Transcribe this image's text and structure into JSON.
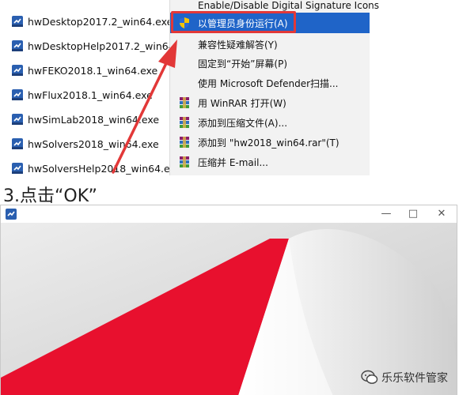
{
  "files": [
    {
      "name": "hwDesktop2017.2_win64.exe"
    },
    {
      "name": "hwDesktopHelp2017.2_win64.exe"
    },
    {
      "name": "hwFEKO2018.1_win64.exe"
    },
    {
      "name": "hwFlux2018.1_win64.exe"
    },
    {
      "name": "hwSimLab2018_win64.exe"
    },
    {
      "name": "hwSolvers2018_win64.exe"
    },
    {
      "name": "hwSolversHelp2018_win64.exe"
    }
  ],
  "context_menu": {
    "items": [
      {
        "label": "Enable/Disable Digital Signature Icons",
        "icon": "none"
      },
      {
        "label": "以管理员身份运行(A)",
        "icon": "shield-icon",
        "highlighted": true
      },
      {
        "label": "兼容性疑难解答(Y)",
        "icon": "none"
      },
      {
        "label": "固定到“开始”屏幕(P)",
        "icon": "none"
      },
      {
        "label": "使用 Microsoft Defender扫描...",
        "icon": "none"
      },
      {
        "label": "用 WinRAR 打开(W)",
        "icon": "winrar-icon"
      },
      {
        "label": "添加到压缩文件(A)...",
        "icon": "winrar-icon"
      },
      {
        "label": "添加到 \"hw2018_win64.rar\"(T)",
        "icon": "winrar-icon"
      },
      {
        "label": "压缩并 E-mail...",
        "icon": "winrar-icon"
      }
    ]
  },
  "step_title": "3.点击“OK”",
  "watermark": {
    "text": "乐乐软件管家"
  },
  "colors": {
    "accent_highlight": "#1f64c8",
    "callout_red": "#e23838",
    "splash_red": "#e8102e"
  }
}
